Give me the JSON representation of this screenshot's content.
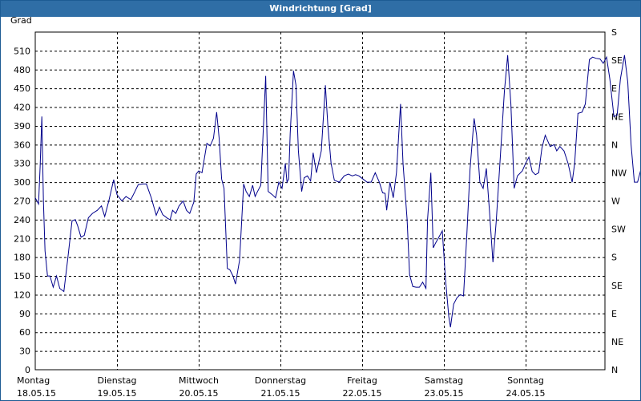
{
  "window": {
    "title": "Windrichtung [Grad]"
  },
  "chart_data": {
    "type": "line",
    "title": "Windrichtung [Grad]",
    "ylabel": "Grad",
    "ylim": [
      0,
      540
    ],
    "y_ticks": [
      0,
      30,
      60,
      90,
      120,
      150,
      180,
      210,
      240,
      270,
      300,
      330,
      360,
      390,
      420,
      450,
      480,
      510
    ],
    "right_axis_labels": [
      "N",
      "NE",
      "E",
      "SE",
      "S",
      "SW",
      "W",
      "NW",
      "N",
      "NE",
      "E",
      "SE",
      "S"
    ],
    "right_axis_values": [
      0,
      45,
      90,
      135,
      180,
      225,
      270,
      315,
      360,
      405,
      450,
      495,
      540
    ],
    "x_labels": [
      {
        "day": "Montag",
        "date": "18.05.15"
      },
      {
        "day": "Dienstag",
        "date": "19.05.15"
      },
      {
        "day": "Mittwoch",
        "date": "20.05.15"
      },
      {
        "day": "Donnerstag",
        "date": "21.05.15"
      },
      {
        "day": "Freitag",
        "date": "22.05.15"
      },
      {
        "day": "Samstag",
        "date": "23.05.15"
      },
      {
        "day": "Sonntag",
        "date": "24.05.15"
      }
    ],
    "x_range_days": [
      0,
      7
    ],
    "grid": true,
    "line_color": "#00008b",
    "series": [
      {
        "points": [
          [
            0.0,
            275
          ],
          [
            0.04,
            265
          ],
          [
            0.06,
            325
          ],
          [
            0.08,
            405
          ],
          [
            0.1,
            270
          ],
          [
            0.12,
            190
          ],
          [
            0.15,
            150
          ],
          [
            0.18,
            150
          ],
          [
            0.22,
            132
          ],
          [
            0.26,
            150
          ],
          [
            0.3,
            130
          ],
          [
            0.35,
            125
          ],
          [
            0.4,
            180
          ],
          [
            0.45,
            238
          ],
          [
            0.49,
            240
          ],
          [
            0.52,
            230
          ],
          [
            0.56,
            212
          ],
          [
            0.6,
            215
          ],
          [
            0.65,
            243
          ],
          [
            0.7,
            250
          ],
          [
            0.76,
            255
          ],
          [
            0.81,
            262
          ],
          [
            0.85,
            245
          ],
          [
            0.9,
            270
          ],
          [
            0.96,
            304
          ],
          [
            1.0,
            280
          ],
          [
            1.06,
            270
          ],
          [
            1.11,
            277
          ],
          [
            1.17,
            272
          ],
          [
            1.22,
            285
          ],
          [
            1.26,
            296
          ],
          [
            1.32,
            297
          ],
          [
            1.36,
            297
          ],
          [
            1.42,
            275
          ],
          [
            1.48,
            247
          ],
          [
            1.52,
            260
          ],
          [
            1.56,
            248
          ],
          [
            1.62,
            242
          ],
          [
            1.65,
            240
          ],
          [
            1.68,
            255
          ],
          [
            1.72,
            250
          ],
          [
            1.76,
            262
          ],
          [
            1.81,
            270
          ],
          [
            1.85,
            255
          ],
          [
            1.89,
            250
          ],
          [
            1.94,
            268
          ],
          [
            1.97,
            313
          ],
          [
            2.0,
            318
          ],
          [
            2.04,
            315
          ],
          [
            2.1,
            362
          ],
          [
            2.14,
            358
          ],
          [
            2.18,
            370
          ],
          [
            2.22,
            412
          ],
          [
            2.25,
            370
          ],
          [
            2.28,
            305
          ],
          [
            2.31,
            290
          ],
          [
            2.35,
            162
          ],
          [
            2.38,
            160
          ],
          [
            2.42,
            150
          ],
          [
            2.45,
            137
          ],
          [
            2.5,
            175
          ],
          [
            2.55,
            297
          ],
          [
            2.58,
            285
          ],
          [
            2.62,
            277
          ],
          [
            2.66,
            295
          ],
          [
            2.69,
            277
          ],
          [
            2.72,
            285
          ],
          [
            2.76,
            295
          ],
          [
            2.82,
            470
          ],
          [
            2.85,
            285
          ],
          [
            2.9,
            280
          ],
          [
            2.94,
            275
          ],
          [
            2.98,
            300
          ],
          [
            3.02,
            290
          ],
          [
            3.06,
            330
          ],
          [
            3.08,
            300
          ],
          [
            3.1,
            305
          ],
          [
            3.12,
            378
          ],
          [
            3.16,
            478
          ],
          [
            3.19,
            455
          ],
          [
            3.22,
            350
          ],
          [
            3.26,
            285
          ],
          [
            3.29,
            307
          ],
          [
            3.33,
            310
          ],
          [
            3.37,
            302
          ],
          [
            3.4,
            347
          ],
          [
            3.44,
            315
          ],
          [
            3.5,
            350
          ],
          [
            3.55,
            455
          ],
          [
            3.58,
            390
          ],
          [
            3.62,
            330
          ],
          [
            3.66,
            303
          ],
          [
            3.72,
            300
          ],
          [
            3.78,
            310
          ],
          [
            3.83,
            313
          ],
          [
            3.88,
            310
          ],
          [
            3.92,
            312
          ],
          [
            3.96,
            310
          ],
          [
            4.01,
            305
          ],
          [
            4.06,
            300
          ],
          [
            4.11,
            300
          ],
          [
            4.16,
            315
          ],
          [
            4.21,
            300
          ],
          [
            4.25,
            283
          ],
          [
            4.28,
            282
          ],
          [
            4.3,
            255
          ],
          [
            4.34,
            300
          ],
          [
            4.38,
            275
          ],
          [
            4.42,
            315
          ],
          [
            4.47,
            425
          ],
          [
            4.5,
            330
          ],
          [
            4.55,
            240
          ],
          [
            4.58,
            152
          ],
          [
            4.62,
            133
          ],
          [
            4.66,
            132
          ],
          [
            4.7,
            132
          ],
          [
            4.74,
            140
          ],
          [
            4.78,
            130
          ],
          [
            4.8,
            240
          ],
          [
            4.84,
            315
          ],
          [
            4.87,
            195
          ],
          [
            4.9,
            203
          ],
          [
            4.93,
            210
          ],
          [
            4.98,
            222
          ],
          [
            5.02,
            145
          ],
          [
            5.06,
            85
          ],
          [
            5.08,
            68
          ],
          [
            5.12,
            105
          ],
          [
            5.16,
            115
          ],
          [
            5.2,
            120
          ],
          [
            5.24,
            118
          ],
          [
            5.28,
            215
          ],
          [
            5.32,
            320
          ],
          [
            5.37,
            402
          ],
          [
            5.4,
            375
          ],
          [
            5.44,
            300
          ],
          [
            5.48,
            290
          ],
          [
            5.52,
            322
          ],
          [
            5.56,
            250
          ],
          [
            5.6,
            172
          ],
          [
            5.64,
            237
          ],
          [
            5.69,
            340
          ],
          [
            5.74,
            445
          ],
          [
            5.78,
            503
          ],
          [
            5.82,
            425
          ],
          [
            5.86,
            290
          ],
          [
            5.9,
            310
          ],
          [
            5.96,
            318
          ],
          [
            6.0,
            330
          ],
          [
            6.04,
            340
          ],
          [
            6.08,
            317
          ],
          [
            6.12,
            312
          ],
          [
            6.16,
            315
          ],
          [
            6.2,
            355
          ],
          [
            6.24,
            375
          ],
          [
            6.3,
            357
          ],
          [
            6.35,
            360
          ],
          [
            6.38,
            350
          ],
          [
            6.42,
            357
          ],
          [
            6.47,
            350
          ],
          [
            6.52,
            330
          ],
          [
            6.57,
            300
          ],
          [
            6.6,
            330
          ],
          [
            6.64,
            410
          ],
          [
            6.69,
            412
          ],
          [
            6.73,
            425
          ],
          [
            6.78,
            496
          ],
          [
            6.82,
            500
          ],
          [
            6.86,
            498
          ],
          [
            6.91,
            497
          ],
          [
            6.95,
            490
          ],
          [
            6.99,
            500
          ],
          [
            7.03,
            465
          ],
          [
            7.08,
            405
          ],
          [
            7.12,
            407
          ],
          [
            7.16,
            465
          ],
          [
            7.21,
            503
          ],
          [
            7.25,
            460
          ],
          [
            7.29,
            360
          ],
          [
            7.33,
            300
          ],
          [
            7.37,
            300
          ],
          [
            7.41,
            320
          ],
          [
            7.45,
            300
          ],
          [
            7.48,
            282
          ],
          [
            7.52,
            260
          ]
        ]
      }
    ]
  }
}
